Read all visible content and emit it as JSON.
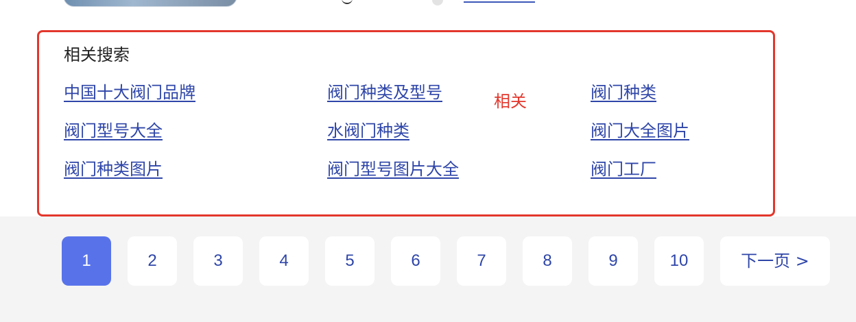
{
  "related": {
    "title": "相关搜索",
    "annotation": "相关",
    "links": [
      "中国十大阀门品牌",
      "阀门种类及型号",
      "阀门种类",
      "阀门型号大全",
      "水阀门种类",
      "阀门大全图片",
      "阀门种类图片",
      "阀门型号图片大全",
      "阀门工厂"
    ]
  },
  "pagination": {
    "pages": [
      "1",
      "2",
      "3",
      "4",
      "5",
      "6",
      "7",
      "8",
      "9",
      "10"
    ],
    "current": "1",
    "next_label": "下一页 >"
  },
  "colors": {
    "link": "#2e45a8",
    "highlight_border": "#e3362b",
    "active_page": "#5873ea",
    "pager_background": "#f4f4f4"
  }
}
